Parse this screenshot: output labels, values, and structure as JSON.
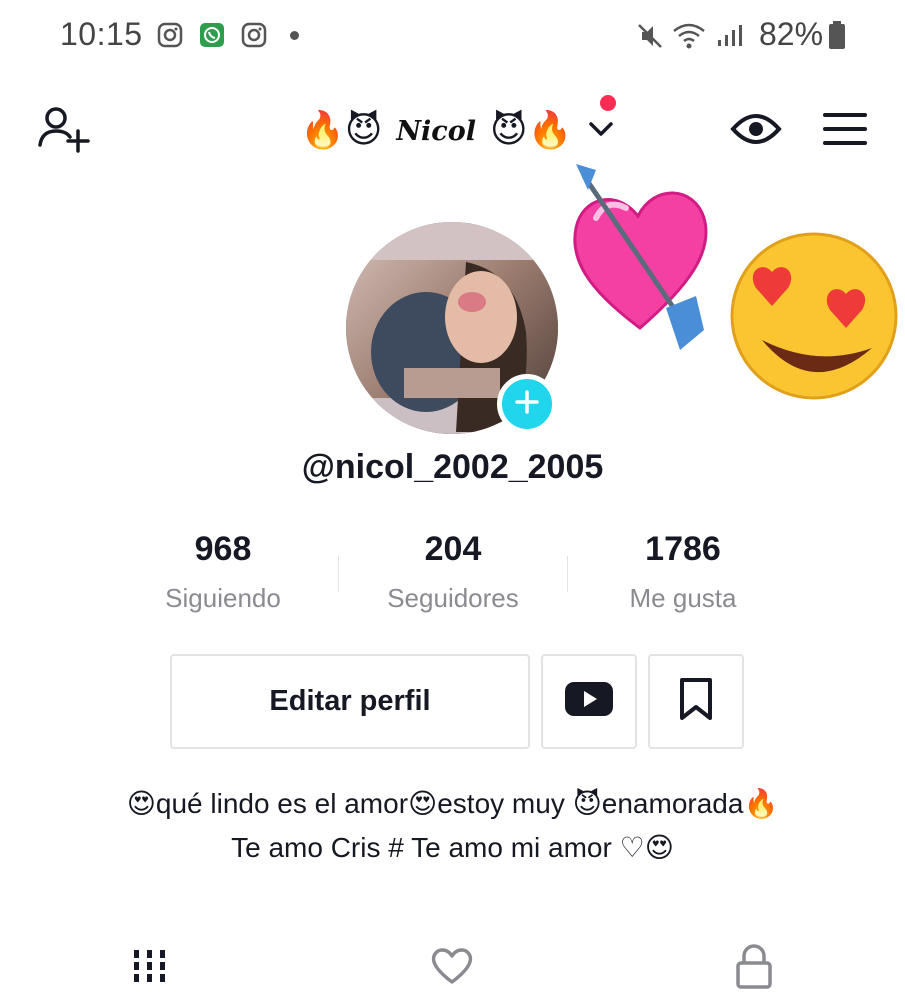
{
  "status_bar": {
    "time": "10:15",
    "battery": "82%",
    "icons": [
      "instagram-icon",
      "whatsapp-icon",
      "instagram-icon",
      "mute-icon",
      "wifi-icon",
      "signal-icon",
      "battery-icon"
    ]
  },
  "header": {
    "title_prefix_emoji": "🔥😈",
    "title": "Nicol",
    "title_suffix_emoji": "😈🔥",
    "icons": [
      "add-friend-icon",
      "chevron-down-icon",
      "eye-icon",
      "menu-icon"
    ]
  },
  "profile": {
    "username": "@nicol_2002_2005",
    "stickers": [
      "heart-arrow-sticker",
      "heart-eyes-emoji-sticker"
    ],
    "stats": [
      {
        "value": "968",
        "label": "Siguiendo"
      },
      {
        "value": "204",
        "label": "Seguidores"
      },
      {
        "value": "1786",
        "label": "Me gusta"
      }
    ],
    "edit_button": "Editar perfil"
  },
  "bio": {
    "line1": "😍qué lindo es el amor😍estoy muy 😈enamorada🔥",
    "line2": "Te amo Cris # Te amo  mi amor ♡😍"
  },
  "tabs": [
    "videos-grid-icon",
    "liked-heart-icon",
    "private-lock-icon"
  ],
  "colors": {
    "accent_red": "#fe2c55",
    "add_button": "#20d5ec",
    "text_primary": "#161823",
    "text_secondary": "#8a8b91"
  }
}
